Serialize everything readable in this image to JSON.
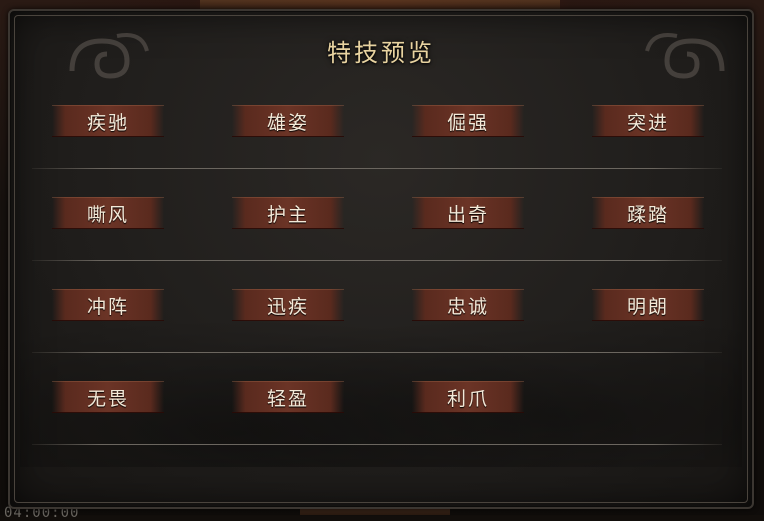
{
  "panel": {
    "title": "特技预览"
  },
  "skills": [
    [
      "疾驰",
      "雄姿",
      "倔强",
      "突进"
    ],
    [
      "嘶风",
      "护主",
      "出奇",
      "蹂踏"
    ],
    [
      "冲阵",
      "迅疾",
      "忠诚",
      "明朗"
    ],
    [
      "无畏",
      "轻盈",
      "利爪"
    ]
  ],
  "footer": {
    "clock_text": "04:00:00"
  },
  "colors": {
    "title_gold": "#e8d3a0",
    "skill_bg": "#6b3426",
    "panel_bg": "#201e1c"
  }
}
